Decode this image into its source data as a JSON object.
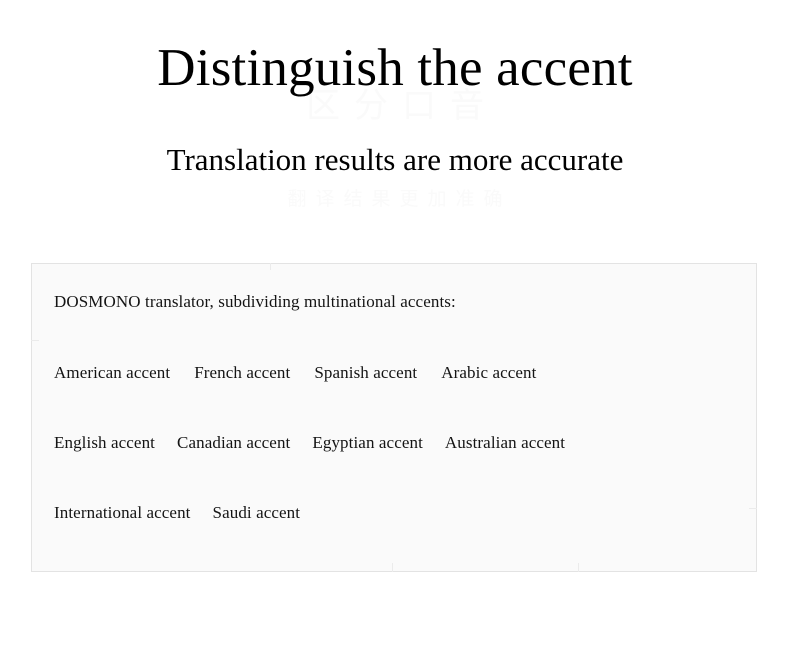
{
  "header": {
    "title": "Distinguish the accent",
    "subtitle": "Translation results are more accurate",
    "ghost_title": "区分口音",
    "ghost_subtitle": "翻译结果更加准确"
  },
  "panel": {
    "heading": "DOSMONO translator, subdividing multinational accents:",
    "rows": [
      {
        "items": [
          {
            "label": "American accent"
          },
          {
            "label": "French accent"
          },
          {
            "label": "Spanish accent"
          },
          {
            "label": "Arabic accent"
          }
        ]
      },
      {
        "items": [
          {
            "label": "English accent"
          },
          {
            "label": "Canadian accent"
          },
          {
            "label": "Egyptian accent"
          },
          {
            "label": "Australian accent"
          }
        ]
      },
      {
        "items": [
          {
            "label": "International accent"
          },
          {
            "label": "Saudi accent"
          }
        ]
      }
    ]
  },
  "colors": {
    "page_background": "#ffffff",
    "panel_background": "#fafafa",
    "panel_border": "#e3e3e3",
    "text": "#141414",
    "title": "#000000",
    "ghost_text": "#fafafa",
    "divider_tick": "#ebebeb"
  }
}
